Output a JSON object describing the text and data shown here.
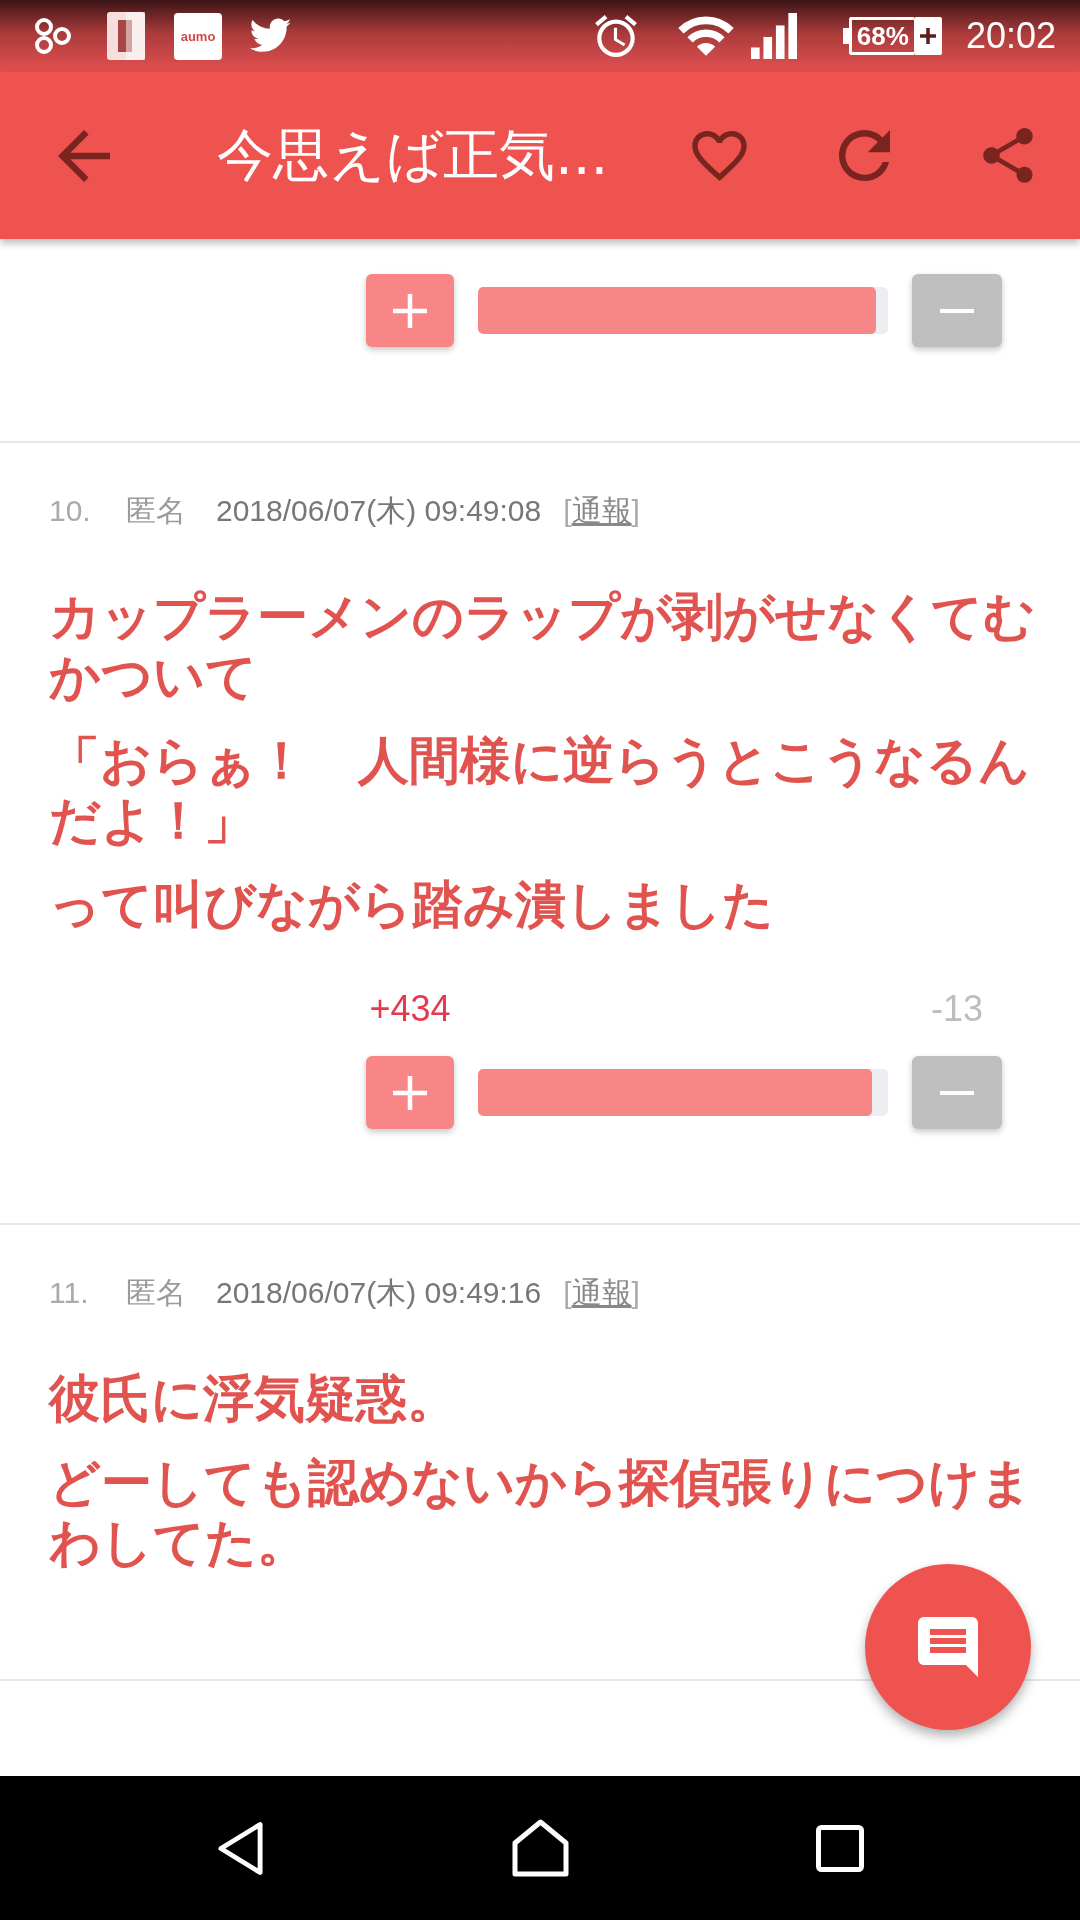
{
  "status_bar": {
    "app_logo_text": "aumo",
    "battery": "68%",
    "time": "20:02"
  },
  "app_bar": {
    "title": "今思えば正気..."
  },
  "posts": [
    {
      "votes": {
        "level": 0.97
      }
    },
    {
      "number": "10.",
      "author": "匿名",
      "date": "2018/06/07(木) 09:49:08",
      "report_link": [
        {
          "text": "[",
          "underlined": false
        },
        {
          "text": "通報",
          "underlined": true
        },
        {
          "text": "]",
          "underlined": false
        }
      ],
      "body": [
        "カップラーメンのラップが剥がせなくてむかついて",
        "「おらぁ！　人間様に逆らうとこうなるんだよ！」",
        "って叫びながら踏み潰しました"
      ],
      "votes": {
        "plus": "+434",
        "minus": "-13",
        "level": 0.96
      }
    },
    {
      "number": "11.",
      "author": "匿名",
      "date": "2018/06/07(木) 09:49:16",
      "report_link": [
        {
          "text": "[",
          "underlined": false
        },
        {
          "text": "通報",
          "underlined": true
        },
        {
          "text": "]",
          "underlined": false
        }
      ],
      "body": [
        "彼氏に浮気疑惑。",
        "どーしても認めないから探偵張りにつけまわしてた。"
      ]
    }
  ]
}
